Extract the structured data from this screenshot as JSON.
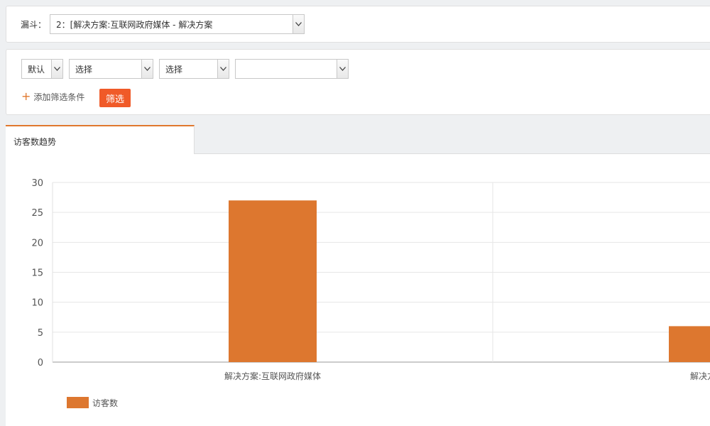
{
  "funnel": {
    "label": "漏斗：",
    "selected": "2：[解决方案:互联网政府媒体 - 解决方案"
  },
  "filters": {
    "select1": "默认",
    "select2": "选择",
    "select3": "选择",
    "select4": "",
    "add_label": "添加筛选条件",
    "add_icon": "plus-icon",
    "button_label": "筛选"
  },
  "tabs": [
    {
      "label": "访客数趋势",
      "active": true
    }
  ],
  "colors": {
    "accent": "#e0782e",
    "button": "#f05a28",
    "bar": "#dd772f"
  },
  "chart_data": {
    "type": "bar",
    "categories": [
      "解决方案:互联网政府媒体",
      "解决方案:电"
    ],
    "series": [
      {
        "name": "访客数",
        "values": [
          27,
          6
        ]
      }
    ],
    "ylim": [
      0,
      30
    ],
    "yticks": [
      "0",
      "5",
      "10",
      "15",
      "20",
      "25",
      "30"
    ],
    "grid": true,
    "legend": "bottom-left"
  }
}
